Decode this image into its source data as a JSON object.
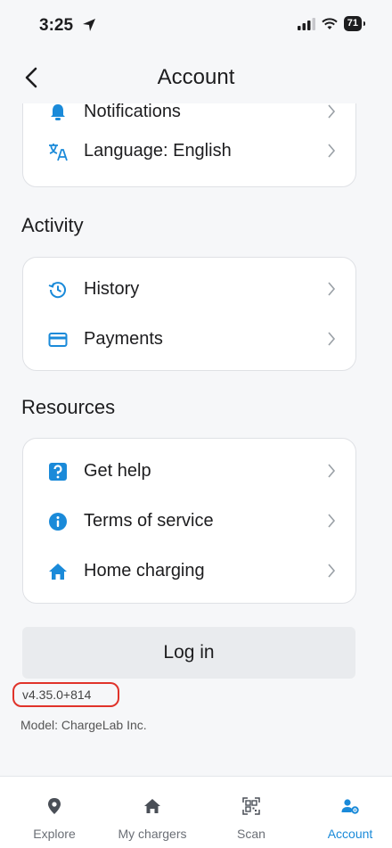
{
  "status_bar": {
    "time": "3:25",
    "battery": "71"
  },
  "nav": {
    "title": "Account"
  },
  "settings": {
    "items": [
      {
        "label": "Notifications"
      },
      {
        "label": "Language: English"
      }
    ]
  },
  "activity": {
    "title": "Activity",
    "items": [
      {
        "label": "History"
      },
      {
        "label": "Payments"
      }
    ]
  },
  "resources": {
    "title": "Resources",
    "items": [
      {
        "label": "Get help"
      },
      {
        "label": "Terms of service"
      },
      {
        "label": "Home charging"
      }
    ]
  },
  "login": {
    "label": "Log in"
  },
  "footer": {
    "version": "v4.35.0+814",
    "model": "Model: ChargeLab Inc."
  },
  "tabs": [
    {
      "label": "Explore"
    },
    {
      "label": "My chargers"
    },
    {
      "label": "Scan"
    },
    {
      "label": "Account"
    }
  ],
  "colors": {
    "accent": "#1a8ad9",
    "highlight": "#e0332a"
  }
}
